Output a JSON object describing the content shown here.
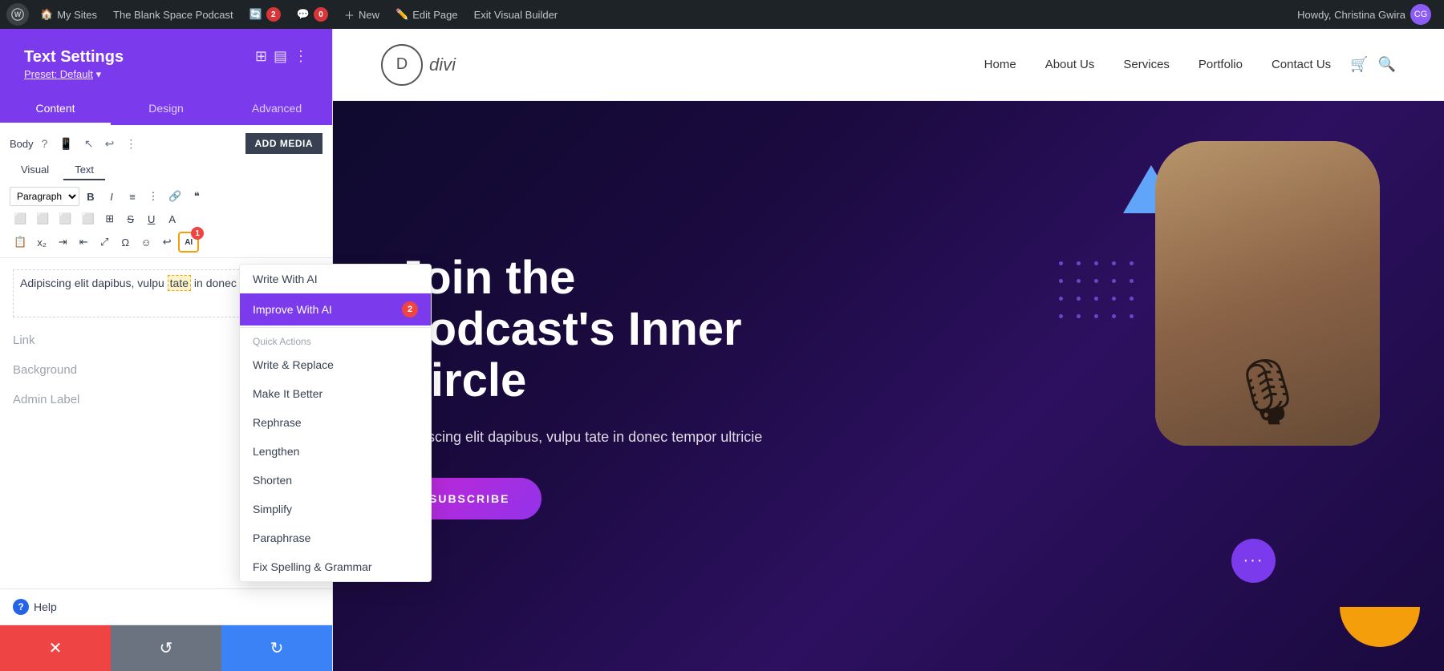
{
  "admin_bar": {
    "wp_label": "WordPress",
    "my_sites": "My Sites",
    "site_name": "The Blank Space Podcast",
    "updates_count": "2",
    "comments_count": "0",
    "new_label": "New",
    "edit_page": "Edit Page",
    "exit_builder": "Exit Visual Builder",
    "howdy": "Howdy, Christina Gwira"
  },
  "panel": {
    "title": "Text Settings",
    "preset": "Preset: Default",
    "tabs": [
      "Content",
      "Design",
      "Advanced"
    ],
    "active_tab": "Content",
    "toolbar": {
      "body_label": "Body",
      "add_media": "ADD MEDIA",
      "visual_tab": "Visual",
      "text_tab": "Text"
    },
    "body_text": "Adipiscing elit dapibus, vulpu tate in donec tempor ultricie",
    "sections": {
      "link": "Link",
      "background": "Background",
      "admin_label": "Admin Label"
    },
    "help": "Help"
  },
  "ai_menu": {
    "write_with_ai": "Write With AI",
    "improve_with_ai": "Improve With AI",
    "improve_badge": "2",
    "quick_actions_label": "Quick Actions",
    "actions": [
      "Write & Replace",
      "Make It Better",
      "Rephrase",
      "Lengthen",
      "Shorten",
      "Simplify",
      "Paraphrase",
      "Fix Spelling & Grammar"
    ]
  },
  "bottom_bar": {
    "close": "✕",
    "undo": "↺",
    "redo": "↻"
  },
  "site": {
    "logo_letter": "D",
    "logo_name": "divi",
    "nav_links": [
      "Home",
      "About Us",
      "Services",
      "Portfolio",
      "Contact Us"
    ],
    "hero_title": "Join the Podcast's Inner Circle",
    "hero_subtitle": "adipiscing elit dapibus, vulpu tate in donec tempor ultricie",
    "subscribe_btn": "SUBSCRIBE"
  }
}
